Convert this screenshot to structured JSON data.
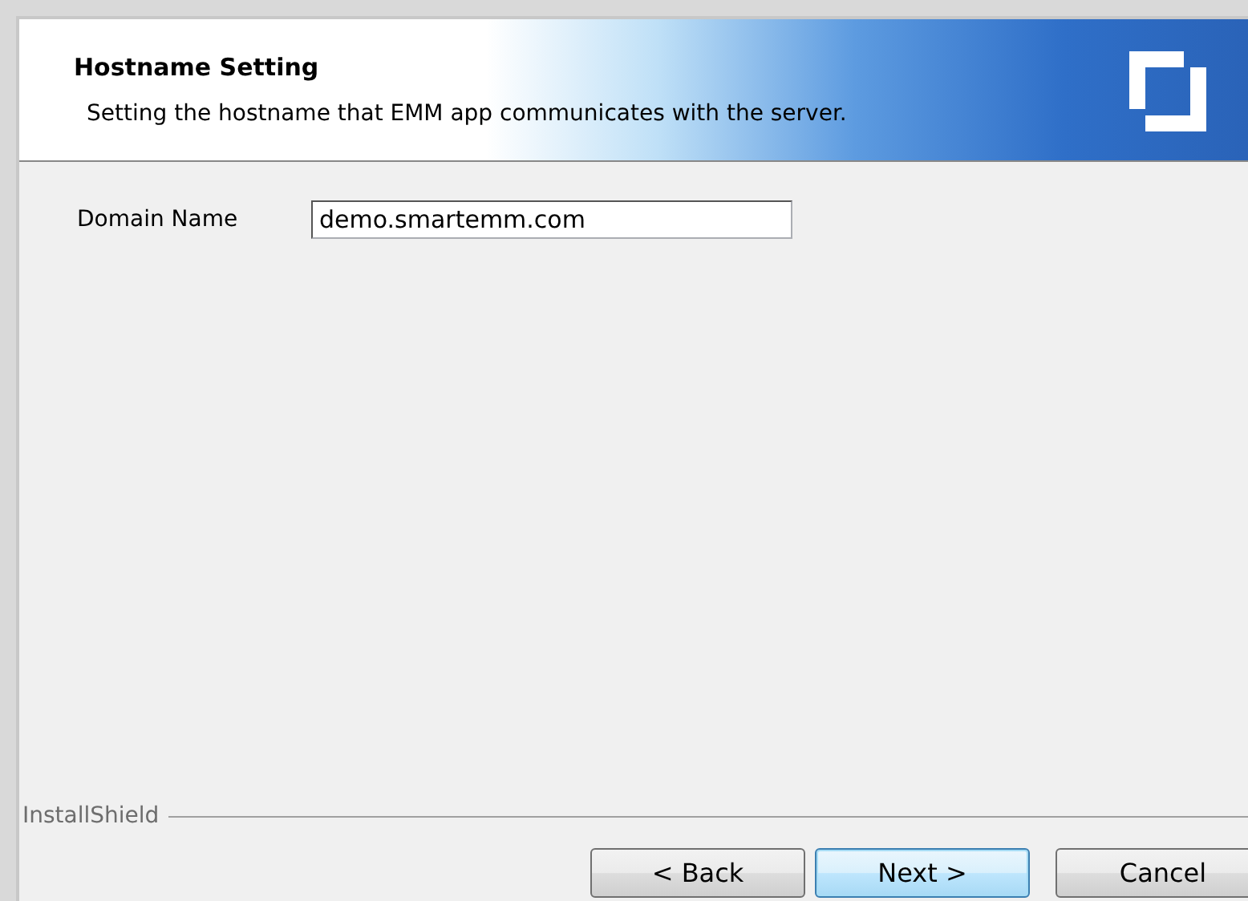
{
  "header": {
    "title": "Hostname Setting",
    "subtitle": "Setting the hostname that EMM app communicates with the server."
  },
  "form": {
    "label": "Domain Name",
    "value": "demo.smartemm.com"
  },
  "footer": {
    "brand": "InstallShield"
  },
  "buttons": [
    {
      "label": "< Back",
      "default": false
    },
    {
      "label": "Next >",
      "default": true
    },
    {
      "label": "Cancel",
      "default": false
    }
  ]
}
